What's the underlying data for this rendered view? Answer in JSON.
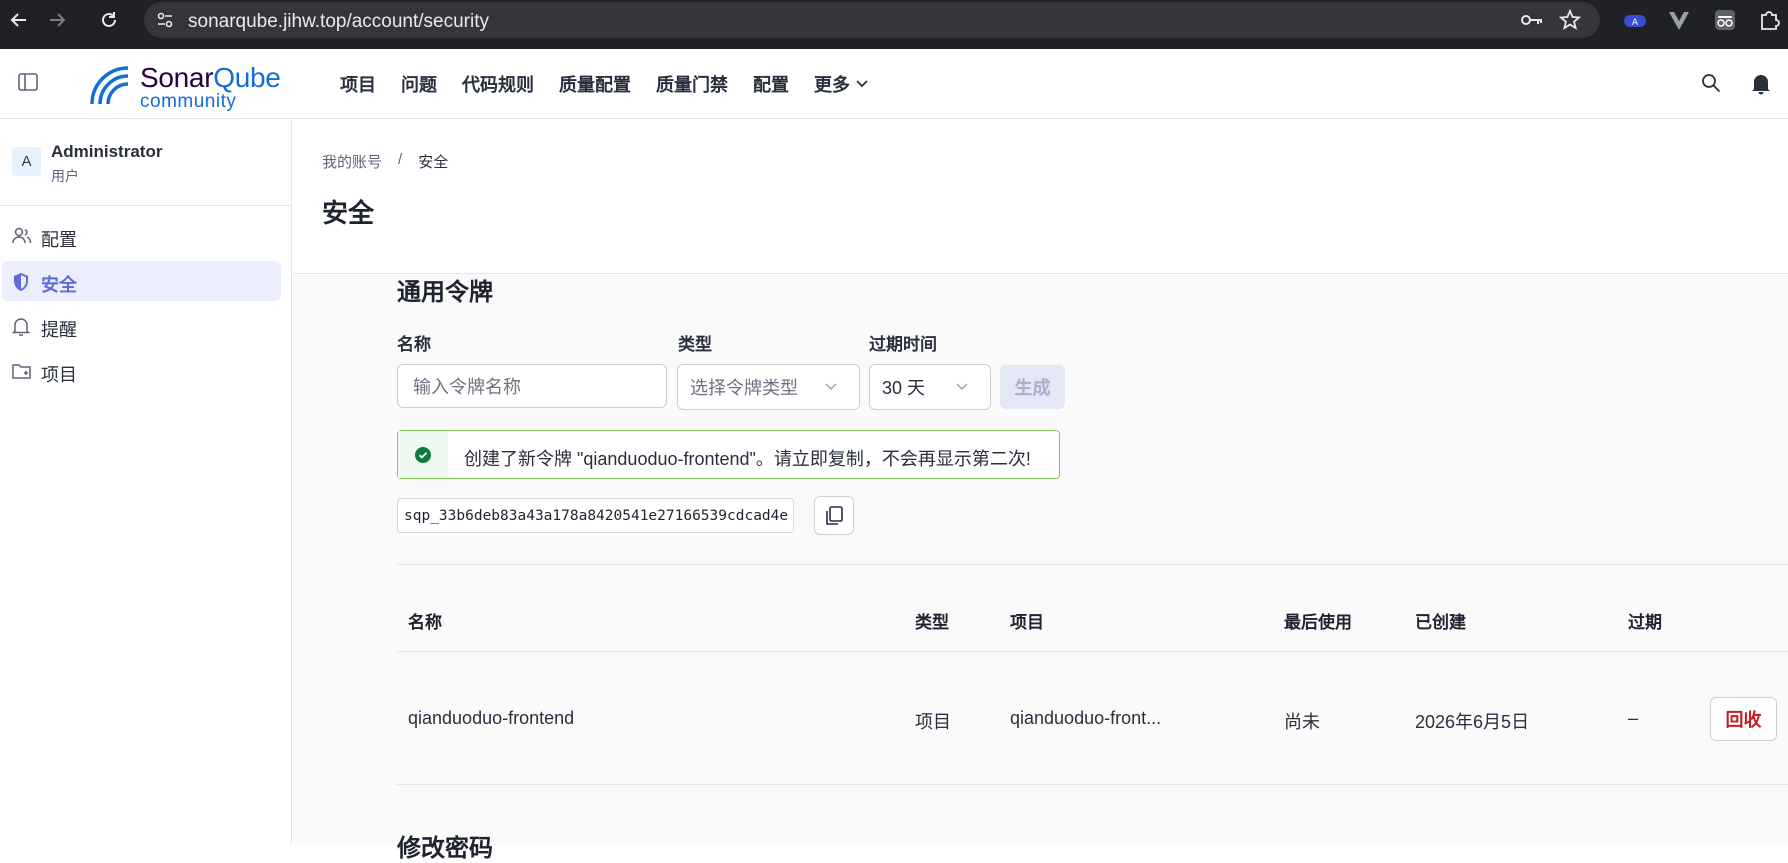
{
  "browser": {
    "url": "sonarqube.jihw.top/account/security"
  },
  "logo": {
    "name_part1": "Sonar",
    "name_part2": "Qube",
    "edition": "community"
  },
  "topnav": {
    "items": [
      "项目",
      "问题",
      "代码规则",
      "质量配置",
      "质量门禁",
      "配置",
      "更多"
    ]
  },
  "sidebar": {
    "avatar_letter": "A",
    "user_name": "Administrator",
    "user_role": "用户",
    "items": [
      {
        "label": "配置",
        "icon": "users-icon"
      },
      {
        "label": "安全",
        "icon": "shield-icon",
        "active": true
      },
      {
        "label": "提醒",
        "icon": "bell-icon"
      },
      {
        "label": "项目",
        "icon": "folder-icon"
      }
    ]
  },
  "breadcrumb": {
    "parent": "我的账号",
    "separator": "/",
    "current": "安全"
  },
  "page_title": "安全",
  "tokens": {
    "section_title": "通用令牌",
    "name_label": "名称",
    "type_label": "类型",
    "expiry_label": "过期时间",
    "name_placeholder": "输入令牌名称",
    "type_placeholder": "选择令牌类型",
    "expiry_value": "30 天",
    "generate_label": "生成",
    "alert_message": "创建了新令牌 \"qianduoduo-frontend\"。请立即复制，不会再显示第二次!",
    "token_value": "sqp_33b6deb83a43a178a8420541e27166539cdcad4e",
    "table": {
      "headers": [
        "名称",
        "类型",
        "项目",
        "最后使用",
        "已创建",
        "过期"
      ],
      "rows": [
        [
          "qianduoduo-frontend",
          "项目",
          "qianduoduo-front...",
          "尚未",
          "2026年6月5日",
          "–"
        ]
      ],
      "revoke_label": "回收"
    }
  },
  "change_password_title": "修改密码",
  "colors": {
    "accent": "#5d6bd9",
    "brand_blue": "#126ed3",
    "success_border": "#7fcc52",
    "danger": "#c91b22"
  }
}
